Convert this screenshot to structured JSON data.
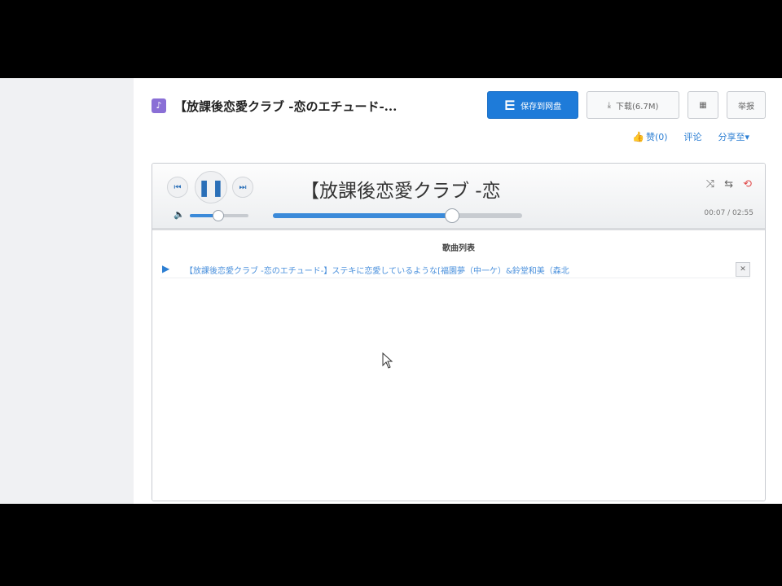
{
  "file": {
    "icon": "music-file-icon",
    "title": "【放課後恋愛クラブ -恋のエチュード-..."
  },
  "toolbar": {
    "save_label": "保存到网盘",
    "download_label": "下载(6.7M)",
    "more_label": "举报"
  },
  "actions": {
    "like_label": "赞(0)",
    "comment_label": "评论",
    "share_label": "分享至"
  },
  "player": {
    "now_playing": "【放課後恋愛クラブ -恋",
    "time": "00:07 / 02:55",
    "progress_fraction": 0.72,
    "volume_fraction": 0.48
  },
  "playlist": {
    "heading": "歌曲列表",
    "tracks": [
      {
        "name": "【放課後恋愛クラブ -恋のエチュード-】ステキに恋愛しているような[福園夢（中一ケ）&鈴堂和美（森北"
      }
    ]
  },
  "colors": {
    "accent": "#1e7bd9",
    "link": "#2d7fd3",
    "repeat_active": "#e04b4b",
    "file_icon": "#8a6fd6"
  }
}
